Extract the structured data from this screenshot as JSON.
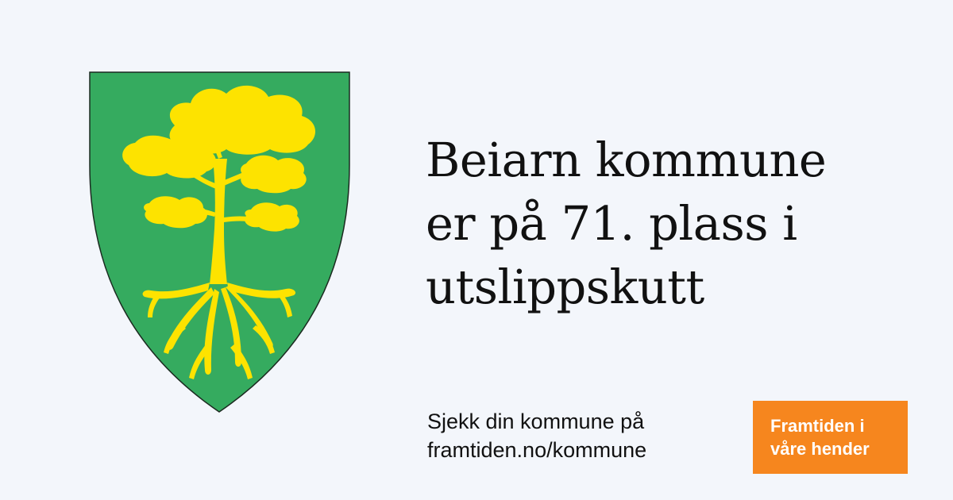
{
  "colors": {
    "background": "#f3f6fb",
    "crest_field": "#35ab5f",
    "crest_charge": "#fde300",
    "crest_outline": "#1b2a20",
    "text": "#111111",
    "badge_background": "#f6861e",
    "badge_text": "#ffffff"
  },
  "crest": {
    "icon": "pine-tree-with-roots-shield-icon"
  },
  "headline": {
    "line1": "Beiarn kommune",
    "line2": "er på 71. plass i",
    "line3": "utslippskutt"
  },
  "cta": {
    "line1": "Sjekk din kommune på",
    "line2": "framtiden.no/kommune"
  },
  "badge": {
    "line1": "Framtiden i",
    "line2": "våre hender"
  }
}
